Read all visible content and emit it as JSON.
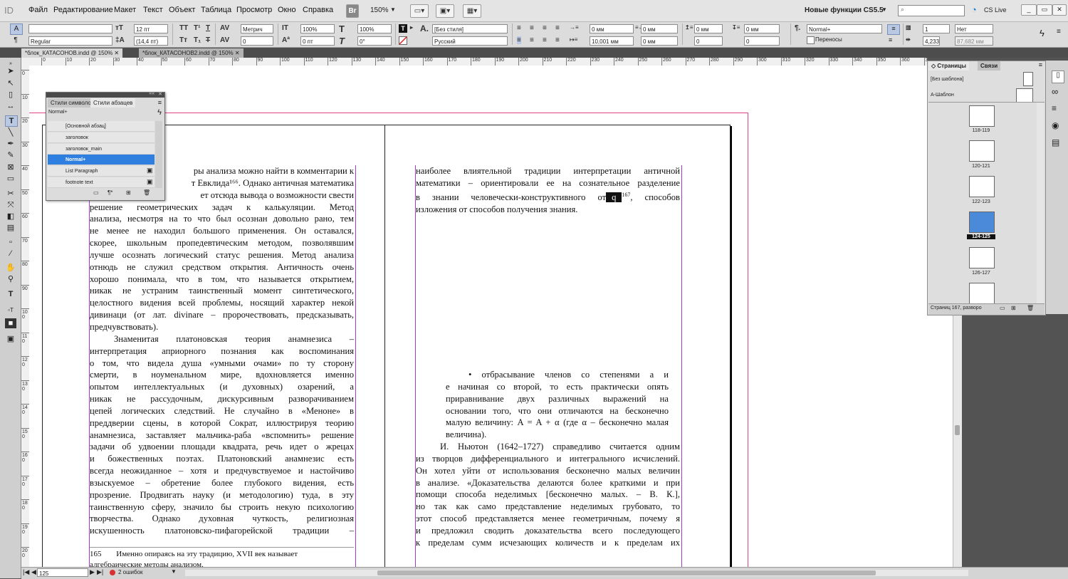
{
  "app": {
    "logo": "ID",
    "menu": [
      "Файл",
      "Редактирование",
      "Макет",
      "Текст",
      "Объект",
      "Таблица",
      "Просмотр",
      "Окно",
      "Справка"
    ],
    "bridge": "Br",
    "zoom": "150%",
    "workspace": "Новые функции CS5.5",
    "cs_live": "CS Live",
    "search_placeholder": ""
  },
  "control": {
    "font_family": "",
    "font_style": "Regular",
    "font_size": "12 пт",
    "leading": "(14,4 пт)",
    "kerning": "Метрич",
    "tracking": "0",
    "vscale": "100%",
    "hscale": "100%",
    "baseline": "0 пт",
    "skew": "0°",
    "char_style": "[Без стиля]",
    "language": "Русский",
    "left_indent": "0 мм",
    "right_indent": "0 мм",
    "first_indent": "10,001 мм",
    "last_indent": "0 мм",
    "space_before": "0 мм",
    "space_after": "0 мм",
    "drop_lines": "0",
    "drop_chars": "0",
    "para_style": "Normal+",
    "hyphenation": "Переносы",
    "columns": "1",
    "col_width": "4,233",
    "gutter": "Нет",
    "extra": "87,682 мм",
    "char_icon": "A",
    "para_icon": "¶"
  },
  "tabs": [
    "*блок_КАТАСОНОВ.indd @ 150%",
    "*блок_КАТАСОНОВ2.indd @ 150%"
  ],
  "ruler_h": [
    "0",
    "10",
    "20",
    "30",
    "40",
    "50",
    "60",
    "70",
    "80",
    "90",
    "100",
    "110",
    "120",
    "130",
    "140",
    "150",
    "160",
    "170",
    "180",
    "190",
    "200",
    "210",
    "220",
    "230",
    "240",
    "250",
    "260",
    "270",
    "280",
    "290",
    "300",
    "310",
    "320",
    "330",
    "340",
    "350",
    "360",
    "370"
  ],
  "ruler_v": [
    "0",
    "10",
    "20",
    "30",
    "40",
    "50",
    "60",
    "70",
    "80",
    "90",
    "100",
    "110",
    "120",
    "130",
    "140",
    "150",
    "160",
    "170",
    "180",
    "190",
    "200",
    "210"
  ],
  "styles_panel": {
    "tab_char": "Стили символов",
    "tab_para": "Стили абзацев",
    "current": "Normal+",
    "items": [
      "[Основной абзац]",
      "заголовок",
      "заголовок_main",
      "Normal+",
      "List Paragraph",
      "footnote text"
    ],
    "selected_index": 3
  },
  "pages_panel": {
    "tab_pages": "Страницы",
    "tab_links": "Связи",
    "master_none": "[Без шаблона]",
    "master_a": "A-Шаблон",
    "spreads": [
      "118-119",
      "120-121",
      "122-123",
      "124-125",
      "126-127"
    ],
    "selected": "124-125",
    "status": "Страниц 167, разворо"
  },
  "left_page": {
    "lines": [
      "ры анализа можно найти в комментарии к",
      "т Евклида¹⁶⁶. Однако античная математика",
      "ет отсюда вывода о возможности свести",
      "решение геометрических задач к калькуляции. Метод",
      "анализа, несмотря на то что был осознан довольно рано, тем",
      "не менее не находил большого применения. Он оставался,",
      "скорее, школьным пропедевтическим методом, позволявшим",
      "лучше осознать логический статус решения. Метод анализа",
      "отнюдь не служил средством открытия. Античность очень",
      "хорошо понимала, что в том, что называется открытием,",
      "никак не устраним таинственный момент синтетического,",
      "целостного видения всей проблемы, носящий характер некой",
      "дивинаци (от лат. divinare – пророчествовать, предсказывать,",
      "предчувствовать)."
    ],
    "para2": [
      "Знаменитая платоновская теория анамнезиса –",
      "интерпретация априорного познания как воспоминания",
      "о том, что видела душа «умными очами» по ту сторону",
      "смерти, в ноуменальном мире, вдохновляется именно",
      "опытом интеллектуальных (и духовных) озарений, а",
      "никак не рассудочным, дискурсивным разворачиванием",
      "цепей логических следствий. Не случайно в «Меноне» в",
      "преддверии сцены, в которой Сократ, иллюстрируя теорию",
      "анамнезиса, заставляет мальчика-раба «вспомнить» решение",
      "задачи об удвоении площади квадрата, речь идет о жрецах",
      "и божественных поэтах. Платоновский анамнезис есть",
      "всегда неожиданное – хотя и предчувствуемое и настойчиво",
      "взыскуемое – обретение более глубокого видения, есть",
      "прозрение. Продвигать науку (и методологию) туда, в эту",
      "таинственную сферу, значило бы строить некую психологию",
      "творчества. Однако духовная чуткость, религиозная",
      "искушенность платоновско-пифагорейской традиции –"
    ],
    "footnote_num": "165",
    "footnote": "Именно опираясь на эту традицию, XVII век называет",
    "footnote2": "алгебраические методы анализом."
  },
  "right_page": {
    "top_lines": [
      "наиболее влиятельной традиции интерпретации античной",
      "математики – ориентировали ее на сознательное разделение",
      "в знании человечески-конструктивного от",
      "изложения от способов получения знания."
    ],
    "selected_glyph": "q",
    "sup167": "167",
    "after_sup": ", способов",
    "bullet": [
      "отбрасывание членов со степенями a и",
      "e начиная со второй, то есть практически опять",
      "приравнивание двух различных выражений на",
      "основании того, что они отличаются на бесконечно",
      "малую величину: A = A + α (где α – бесконечно малая",
      "величина)."
    ],
    "para": [
      "И. Ньютон (1642–1727) справедливо считается одним",
      "из творцов дифференциального и интегрального исчислений.",
      "Он хотел уйти от использования бесконечно малых величин",
      "в анализе. «Доказательства делаются более краткими и при",
      "помощи способа неделимых [бесконечно малых. – В. К.],",
      "но так как само представление неделимых грубовато, то",
      "этот способ представляется менее геометричным, почему я",
      "и предложил сводить доказательства всего последующего",
      "к пределам сумм исчезающих количеств и к пределам их"
    ]
  },
  "status": {
    "page": "125",
    "errors": "2 ошибок"
  },
  "colors": {
    "accent": "#2f7fe0",
    "margin": "#e0448c",
    "column": "#a23cc8"
  }
}
